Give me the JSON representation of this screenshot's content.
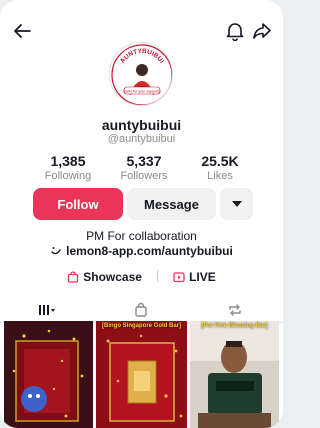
{
  "profile": {
    "avatar_ring_text": "AUNTYBUIBUI",
    "avatar_caption": "(hello for your support!)",
    "username": "auntybuibui",
    "handle": "@auntybuibui"
  },
  "stats": [
    {
      "value": "1,385",
      "label": "Following"
    },
    {
      "value": "5,337",
      "label": "Followers"
    },
    {
      "value": "25.5K",
      "label": "Likes"
    }
  ],
  "actions": {
    "follow_label": "Follow",
    "message_label": "Message"
  },
  "bio": {
    "text": "PM For collaboration",
    "link": "lemon8-app.com/auntybuibui"
  },
  "extras": {
    "showcase_label": "Showcase",
    "live_label": "LIVE"
  },
  "videos": [
    {
      "caption": ""
    },
    {
      "caption": "[Bingo Singapore Gold Bar]"
    },
    {
      "caption": "[For Fine Blessing Bar]"
    }
  ],
  "colors": {
    "accent": "#ea3558",
    "secondary_button": "#f1f1f2"
  }
}
